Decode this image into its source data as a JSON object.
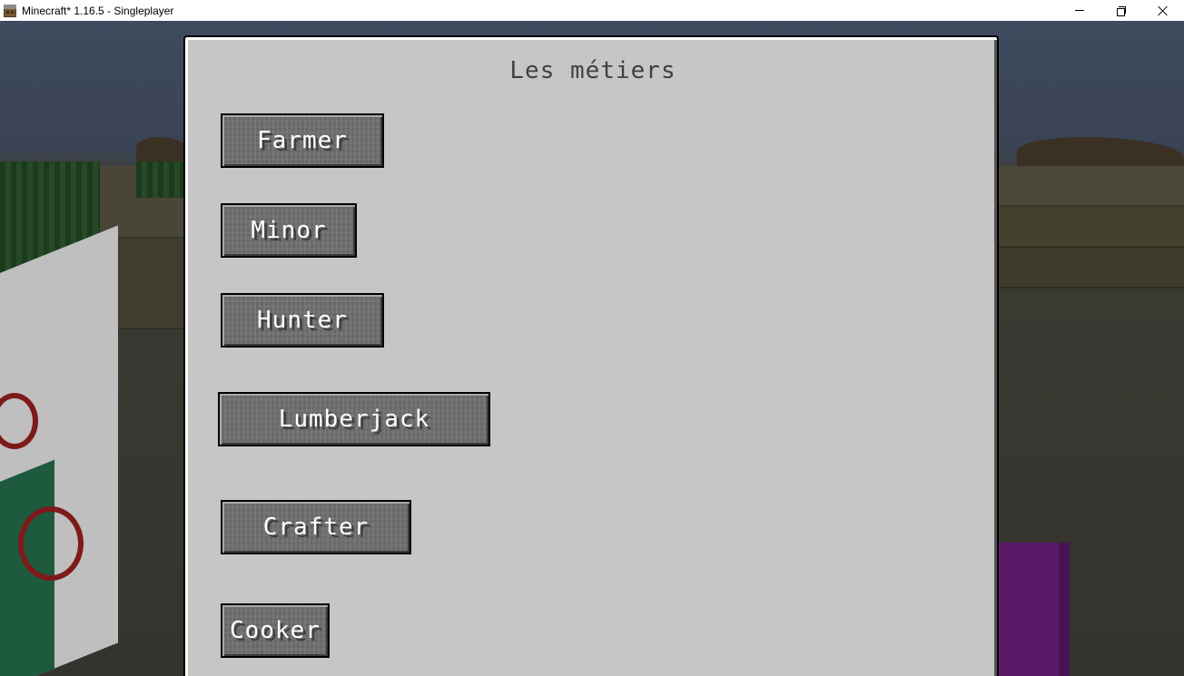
{
  "window": {
    "title": "Minecraft* 1.16.5 - Singleplayer",
    "controls": {
      "minimize_icon": "minimize-icon",
      "restore_icon": "restore-icon",
      "close_icon": "close-icon"
    }
  },
  "gui": {
    "title": "Les métiers",
    "buttons": [
      {
        "id": "farmer",
        "label": "Farmer"
      },
      {
        "id": "minor",
        "label": "Minor"
      },
      {
        "id": "hunter",
        "label": "Hunter"
      },
      {
        "id": "lumberjack",
        "label": "Lumberjack"
      },
      {
        "id": "crafter",
        "label": "Crafter"
      },
      {
        "id": "cooker",
        "label": "Cooker"
      }
    ]
  },
  "colors": {
    "panel_background": "#c6c6c6",
    "button_background": "#6f6f6f",
    "button_text": "#ffffff",
    "title_text": "#404040"
  }
}
